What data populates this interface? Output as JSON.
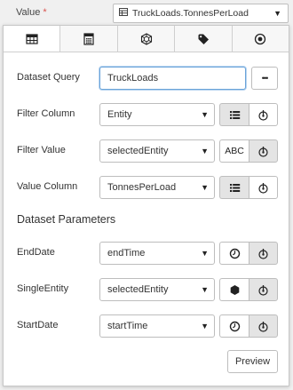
{
  "value_field": {
    "label": "Value",
    "required_mark": "*",
    "selected": "TruckLoads.TonnesPerLoad"
  },
  "tabs": [
    {
      "icon": "table-icon",
      "active": true
    },
    {
      "icon": "calculator-icon",
      "active": false
    },
    {
      "icon": "network-icon",
      "active": false
    },
    {
      "icon": "tag-icon",
      "active": false
    },
    {
      "icon": "target-icon",
      "active": false
    }
  ],
  "dataset_query": {
    "label": "Dataset Query",
    "value": "TruckLoads",
    "more_label": "•••"
  },
  "filter_column": {
    "label": "Filter Column",
    "value": "Entity"
  },
  "filter_value": {
    "label": "Filter Value",
    "value": "selectedEntity",
    "mode_label": "ABC"
  },
  "value_column": {
    "label": "Value Column",
    "value": "TonnesPerLoad"
  },
  "parameters": {
    "title": "Dataset Parameters",
    "items": [
      {
        "label": "EndDate",
        "value": "endTime",
        "icon": "clock-icon"
      },
      {
        "label": "SingleEntity",
        "value": "selectedEntity",
        "icon": "hexagon-icon"
      },
      {
        "label": "StartDate",
        "value": "startTime",
        "icon": "clock-icon"
      }
    ]
  },
  "preview_label": "Preview"
}
